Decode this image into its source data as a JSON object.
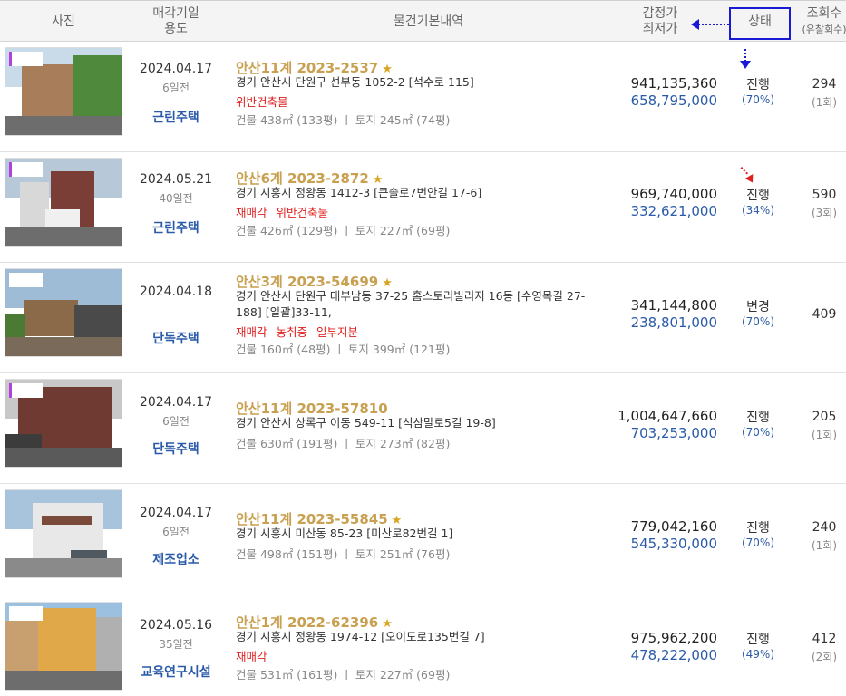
{
  "header": {
    "photo": "사진",
    "sale_date_l1": "매각기일",
    "sale_date_l2": "용도",
    "basic": "물건기본내역",
    "price_l1": "감정가",
    "price_l2": "최저가",
    "status": "상태",
    "views_l1": "조회수",
    "views_l2": "(유찰회수)"
  },
  "colors": {
    "accent_blue": "#1a1ad6",
    "case_gold": "#c8a050",
    "flag_red": "#e02020",
    "price_blue": "#2a5aa8"
  },
  "rows": [
    {
      "date": "2024.04.17",
      "ago": "6일전",
      "use": "근린주택",
      "case": "안산11계 2023-2537",
      "starred": true,
      "address": "경기 안산시 단원구 선부동 1052-2 [석수로 115]",
      "flags": [
        "위반건축물"
      ],
      "area": "건물 438㎡ (133평)  ㅣ  토지 245㎡ (74평)",
      "appraisal": "941,135,360",
      "minimum": "658,795,000",
      "status": "진행",
      "percent": "(70%)",
      "views": "294",
      "fails": "(1회)"
    },
    {
      "date": "2024.05.21",
      "ago": "40일전",
      "use": "근린주택",
      "case": "안산6계 2023-2872",
      "starred": true,
      "address": "경기 시흥시 정왕동 1412-3 [큰솔로7번안길 17-6]",
      "flags": [
        "재매각",
        "위반건축물"
      ],
      "area": "건물 426㎡ (129평)  ㅣ  토지 227㎡ (69평)",
      "appraisal": "969,740,000",
      "minimum": "332,621,000",
      "status": "진행",
      "percent": "(34%)",
      "views": "590",
      "fails": "(3회)"
    },
    {
      "date": "2024.04.18",
      "ago": "",
      "use": "단독주택",
      "case": "안산3계 2023-54699",
      "starred": true,
      "address": "경기 안산시 단원구 대부남동 37-25 홈스토리빌리지 16동 [수영목길 27-188] [일괄]33-11,",
      "flags": [
        "재매각",
        "농취증",
        "일부지분"
      ],
      "area": "건물 160㎡ (48평)  ㅣ  토지 399㎡ (121평)",
      "appraisal": "341,144,800",
      "minimum": "238,801,000",
      "status": "변경",
      "percent": "(70%)",
      "views": "409",
      "fails": ""
    },
    {
      "date": "2024.04.17",
      "ago": "6일전",
      "use": "단독주택",
      "case": "안산11계 2023-57810",
      "starred": false,
      "address": "경기 안산시 상록구 이동 549-11 [석삼말로5길 19-8]",
      "flags": [],
      "area": "건물 630㎡ (191평)  ㅣ  토지 273㎡ (82평)",
      "appraisal": "1,004,647,660",
      "minimum": "703,253,000",
      "status": "진행",
      "percent": "(70%)",
      "views": "205",
      "fails": "(1회)"
    },
    {
      "date": "2024.04.17",
      "ago": "6일전",
      "use": "제조업소",
      "case": "안산11계 2023-55845",
      "starred": true,
      "address": "경기 시흥시 미산동 85-23 [미산로82번길 1]",
      "flags": [],
      "area": "건물 498㎡ (151평)  ㅣ  토지 251㎡ (76평)",
      "appraisal": "779,042,160",
      "minimum": "545,330,000",
      "status": "진행",
      "percent": "(70%)",
      "views": "240",
      "fails": "(1회)"
    },
    {
      "date": "2024.05.16",
      "ago": "35일전",
      "use": "교육연구시설",
      "case": "안산1계 2022-62396",
      "starred": true,
      "address": "경기 시흥시 정왕동 1974-12 [오이도로135번길 7]",
      "flags": [
        "재매각"
      ],
      "area": "건물 531㎡ (161평)  ㅣ  토지 227㎡ (69평)",
      "appraisal": "975,962,200",
      "minimum": "478,222,000",
      "status": "진행",
      "percent": "(49%)",
      "views": "412",
      "fails": "(2회)"
    }
  ]
}
